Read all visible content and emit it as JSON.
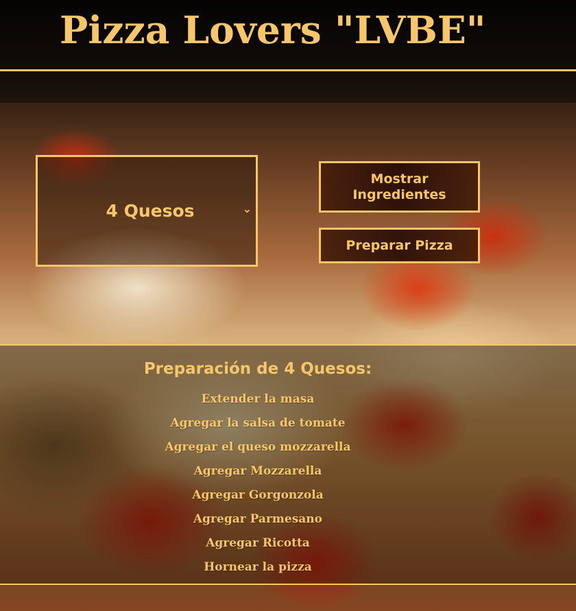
{
  "header": {
    "title": "Pizza Lovers \"LVBE\""
  },
  "controls": {
    "pizza_select": {
      "value": "4 Quesos"
    },
    "show_ingredients_button": "Mostrar Ingredientes",
    "prepare_pizza_button": "Preparar Pizza"
  },
  "preparation": {
    "title": "Preparación de 4 Quesos:",
    "steps": [
      "Extender la masa",
      "Agregar la salsa de tomate",
      "Agregar el queso mozzarella",
      "Agregar Mozzarella",
      "Agregar Gorgonzola",
      "Agregar Parmesano",
      "Agregar Ricotta",
      "Hornear la pizza"
    ]
  },
  "colors": {
    "accent": "#f7c66a",
    "button_background": "#3b160a",
    "page_background": "#9b5a2e"
  },
  "icons": {
    "select_chevron": "chevron-down-icon"
  }
}
